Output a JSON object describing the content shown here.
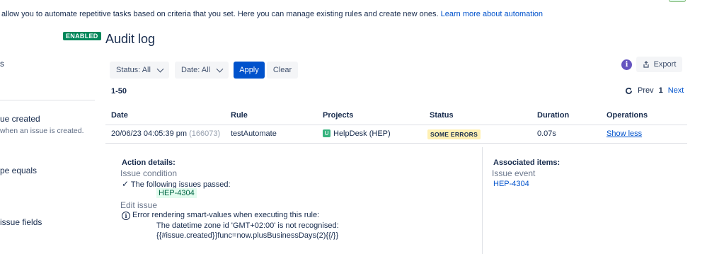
{
  "intro": {
    "text": "allow you to automate repetitive tasks based on criteria that you set. Here you can manage existing rules and create new ones.",
    "link": "Learn more about automation"
  },
  "sidebar": {
    "badge": "ENABLED",
    "items": [
      {
        "label": "s"
      },
      {
        "label": "ue created",
        "sub": "when an issue is created."
      },
      {
        "label": "pe equals"
      },
      {
        "label": "issue fields"
      }
    ]
  },
  "page": {
    "title": "Audit log"
  },
  "filters": {
    "status": "Status: All",
    "date": "Date: All",
    "apply": "Apply",
    "clear": "Clear"
  },
  "toolbar": {
    "info": "i",
    "export": "Export"
  },
  "pagination": {
    "range": "1-50",
    "prev": "Prev",
    "current": "1",
    "next": "Next"
  },
  "table": {
    "columns": [
      "Date",
      "Rule",
      "Projects",
      "Status",
      "Duration",
      "Operations"
    ],
    "row": {
      "date": "20/06/23 04:05:39 pm",
      "id": "(166073)",
      "rule": "testAutomate",
      "project": "HelpDesk (HEP)",
      "status": "SOME ERRORS",
      "duration": "0.07s",
      "operation": "Show less"
    }
  },
  "details": {
    "action_heading": "Action details:",
    "condition_title": "Issue condition",
    "condition_text": "The following issues passed:",
    "condition_issue": "HEP-4304",
    "edit_title": "Edit issue",
    "error_text": "Error rendering smart-values when executing this rule:",
    "error_detail_1": "The datetime zone id 'GMT+02:00' is not recognised:",
    "error_detail_2": "{{#issue.created}}func=now.plusBusinessDays(2){{/}}",
    "assoc_heading": "Associated items:",
    "assoc_title": "Issue event",
    "assoc_issue": "HEP-4304"
  },
  "colors": {
    "primary": "#0052cc",
    "enabled": "#00875a",
    "info": "#6554c0",
    "warning_bg": "#fff0b3"
  },
  "icons": [
    "chevron-down-icon",
    "info-icon",
    "export-icon",
    "refresh-icon",
    "project-icon",
    "check-icon",
    "error-info-icon"
  ]
}
